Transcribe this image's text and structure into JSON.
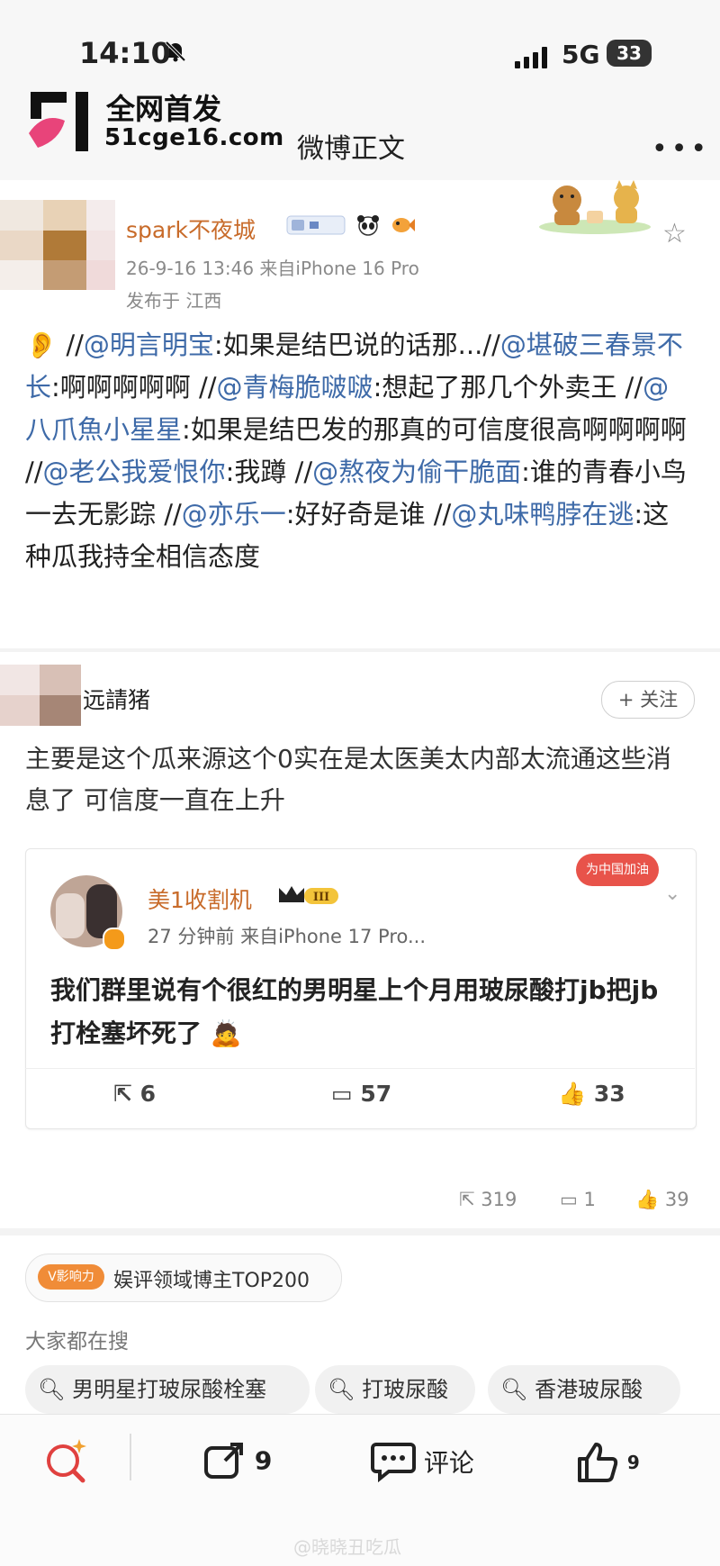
{
  "status_bar": {
    "time": "14:10",
    "network": "5G",
    "battery": "33"
  },
  "watermark_logo": {
    "line1": "全网首发",
    "line2": "51cge16.com"
  },
  "header": {
    "title": "微博正文",
    "more": "•••"
  },
  "post": {
    "author": "spark不夜城",
    "meta_time": "26-9-16 13:46",
    "meta_source": "来自iPhone 16 Pro",
    "meta_location": "发布于 江西",
    "segments": [
      {
        "text": "👂 //",
        "link": false
      },
      {
        "text": "@明言明宝",
        "link": true
      },
      {
        "text": ":如果是结巴说的话那...//",
        "link": false
      },
      {
        "text": "@堪破三春景不长",
        "link": true
      },
      {
        "text": ":啊啊啊啊啊 //",
        "link": false
      },
      {
        "text": "@青梅脆啵啵",
        "link": true
      },
      {
        "text": ":想起了那几个外卖王 //",
        "link": false
      },
      {
        "text": "@八爪魚小星星",
        "link": true
      },
      {
        "text": ":如果是结巴发的那真的可信度很高啊啊啊啊 //",
        "link": false
      },
      {
        "text": "@老公我爱恨你",
        "link": true
      },
      {
        "text": ":我蹲 //",
        "link": false
      },
      {
        "text": "@熬夜为偷干脆面",
        "link": true
      },
      {
        "text": ":谁的青春小鸟一去无影踪 //",
        "link": false
      },
      {
        "text": "@亦乐一",
        "link": true
      },
      {
        "text": ":好好奇是谁 //",
        "link": false
      },
      {
        "text": "@丸味鸭脖在逃",
        "link": true
      },
      {
        "text": ":这种瓜我持全相信态度",
        "link": false
      }
    ]
  },
  "comment": {
    "author": "远請猪",
    "follow_label": "+ 关注",
    "text": "主要是这个瓜来源这个0实在是太医美太内部太流通这些消息了 可信度一直在上升",
    "quoted": {
      "author": "美1收割机",
      "level": "III",
      "meta": "27 分钟前  来自iPhone 17 Pro...",
      "tag": "为中国加油",
      "text": "我们群里说有个很红的男明星上个月用玻尿酸打jb把jb打栓塞坏死了 🙇",
      "reposts": "6",
      "comments": "57",
      "likes": "33"
    },
    "stats": {
      "reposts": "319",
      "comments": "1",
      "likes": "39"
    }
  },
  "influence": {
    "badge": "V影响力",
    "text": "娱评领域博主TOP200"
  },
  "hot_search": {
    "title": "大家都在搜",
    "items": [
      "男明星打玻尿酸栓塞",
      "打玻尿酸",
      "香港玻尿酸"
    ]
  },
  "tab_bar": {
    "repost_count": "9",
    "comment_label": "评论",
    "like_count": "9"
  },
  "bottom_watermark": "@晓晓丑吃瓜",
  "colors": {
    "link": "#3e6aa8",
    "username": "#c86b2a",
    "accent": "#f08c38"
  }
}
